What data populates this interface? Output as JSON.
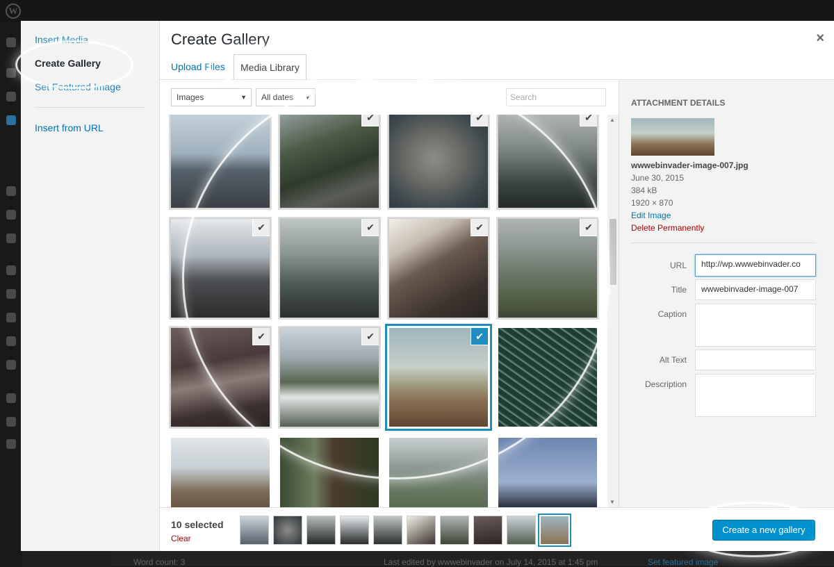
{
  "menu": {
    "items": [
      "Insert Media",
      "Create Gallery",
      "Set Featured Image",
      "Insert from URL"
    ],
    "active": "Create Gallery"
  },
  "modal": {
    "title": "Create Gallery",
    "close": "×",
    "tabs": [
      "Upload Files",
      "Media Library"
    ],
    "active_tab": "Media Library"
  },
  "toolbar": {
    "filter_type": "Images",
    "filter_date": "All dates",
    "search_placeholder": "Search"
  },
  "attachment": {
    "heading": "ATTACHMENT DETAILS",
    "filename": "wwwebinvader-image-007.jpg",
    "date": "June 30, 2015",
    "size": "384 kB",
    "dimensions": "1920 × 870",
    "edit_link": "Edit Image",
    "delete_link": "Delete Permanently",
    "fields": {
      "url_label": "URL",
      "url_value": "http://wp.wwwebinvader.co",
      "title_label": "Title",
      "title_value": "wwwebinvader-image-007",
      "caption_label": "Caption",
      "caption_value": "",
      "alt_label": "Alt Text",
      "alt_value": "",
      "desc_label": "Description",
      "desc_value": ""
    }
  },
  "footer": {
    "selected_count": "10 selected",
    "clear": "Clear",
    "create_button": "Create a new gallery"
  },
  "background": {
    "word_count": "Word count: 3",
    "last_edited": "Last edited by wwwebinvader on July 14, 2015 at 1:45 pm",
    "featured": "Set featured image"
  },
  "icons": {
    "check": "✔",
    "select_arrow": "▼",
    "scroll_up": "▲",
    "scroll_down": "▼",
    "wp": "W"
  },
  "colors": {
    "accent": "#0073aa",
    "selection": "#1e8cbe",
    "danger": "#aa0000",
    "button": "#0091cd"
  }
}
